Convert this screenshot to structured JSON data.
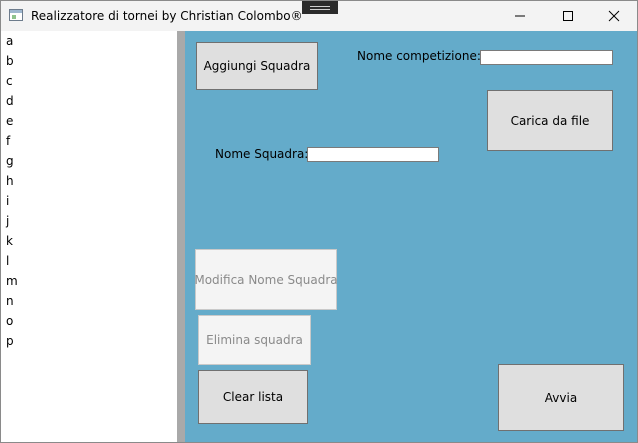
{
  "window": {
    "title": "Realizzatore di tornei by Christian Colombo®"
  },
  "team_list": {
    "items": [
      "a",
      "b",
      "c",
      "d",
      "e",
      "f",
      "g",
      "h",
      "i",
      "j",
      "k",
      "l",
      "m",
      "n",
      "o",
      "p"
    ]
  },
  "form": {
    "add_team_label": "Aggiungi Squadra",
    "competition_name_label": "Nome competizione:",
    "competition_name_value": "",
    "load_file_label": "Carica da file",
    "team_name_label": "Nome Squadra:",
    "team_name_value": "",
    "edit_team_label": "Modifica Nome Squadra",
    "delete_team_label": "Elimina squadra",
    "clear_list_label": "Clear lista",
    "start_label": "Avvia"
  },
  "colors": {
    "panel_background": "#64abca",
    "splitter": "#a9a9a9",
    "button_background": "#dfdfdf"
  }
}
